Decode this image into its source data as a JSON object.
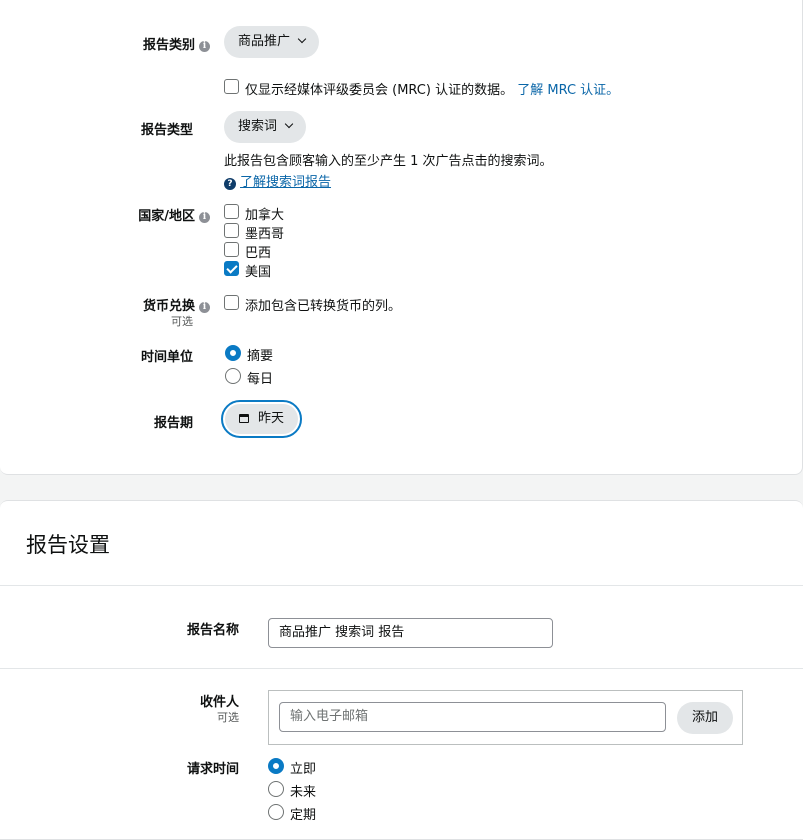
{
  "report_category": {
    "label": "报告类别",
    "selected": "商品推广",
    "mrc_checkbox_label": "仅显示经媒体评级委员会 (MRC) 认证的数据。",
    "mrc_link": "了解 MRC 认证。",
    "mrc_checked": false
  },
  "report_type": {
    "label": "报告类型",
    "selected": "搜索词",
    "description": "此报告包含顾客输入的至少产生 1 次广告点击的搜索词。",
    "help_link": "了解搜索词报告"
  },
  "country": {
    "label": "国家/地区",
    "options": [
      {
        "label": "加拿大",
        "checked": false
      },
      {
        "label": "墨西哥",
        "checked": false
      },
      {
        "label": "巴西",
        "checked": false
      },
      {
        "label": "美国",
        "checked": true
      }
    ]
  },
  "currency": {
    "label": "货币兑换",
    "optional": "可选",
    "checkbox_label": "添加包含已转换货币的列。",
    "checked": false
  },
  "time_unit": {
    "label": "时间单位",
    "options": [
      {
        "label": "摘要",
        "selected": true
      },
      {
        "label": "每日",
        "selected": false
      }
    ]
  },
  "report_period": {
    "label": "报告期",
    "value": "昨天"
  },
  "settings": {
    "title": "报告设置",
    "name_label": "报告名称",
    "name_value": "商品推广 搜索词 报告",
    "recipients_label": "收件人",
    "recipients_optional": "可选",
    "email_placeholder": "输入电子邮箱",
    "add_button": "添加",
    "request_time_label": "请求时间",
    "request_options": [
      {
        "label": "立即",
        "selected": true
      },
      {
        "label": "未来",
        "selected": false
      },
      {
        "label": "定期",
        "selected": false
      }
    ]
  },
  "colors": {
    "accent": "#0a7ac4",
    "link": "#0a66a8",
    "pill_bg": "#e3e6e8"
  },
  "icons": [
    "info-icon",
    "chevron-down-icon",
    "question-circle-icon",
    "calendar-icon",
    "checkmark-icon"
  ]
}
